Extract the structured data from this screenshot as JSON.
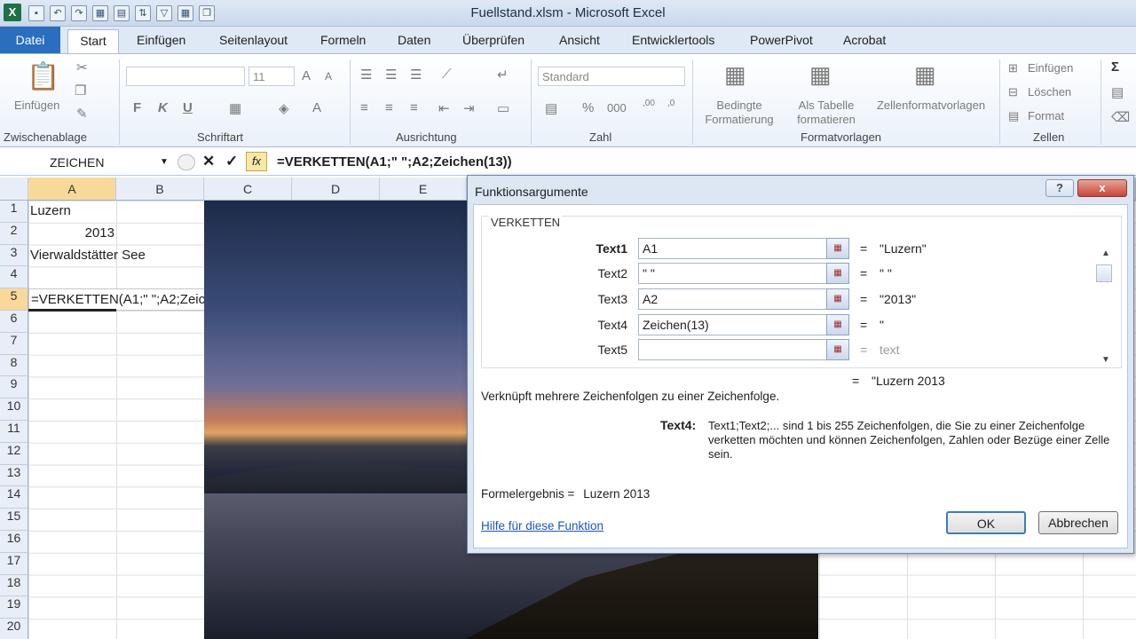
{
  "window": {
    "title": "Fuellstand.xlsm  -  Microsoft Excel",
    "app_icon": "X"
  },
  "tabs": {
    "file": "Datei",
    "items": [
      "Start",
      "Einfügen",
      "Seitenlayout",
      "Formeln",
      "Daten",
      "Überprüfen",
      "Ansicht",
      "Entwicklertools",
      "PowerPivot",
      "Acrobat"
    ],
    "active": "Start"
  },
  "ribbon": {
    "clipboard": {
      "paste": "Einfügen",
      "label": "Zwischenablage"
    },
    "font": {
      "name": "",
      "size": "11",
      "label": "Schriftart",
      "bold": "F",
      "italic": "K",
      "underline": "U"
    },
    "alignment": {
      "label": "Ausrichtung"
    },
    "number": {
      "format": "Standard",
      "percent": "%",
      "thousands": "000",
      "label": "Zahl"
    },
    "styles": {
      "conditional": "Bedingte\nFormatierung",
      "as_table": "Als Tabelle\nformatieren",
      "cell_styles": "Zellenformatvorlagen",
      "label": "Formatvorlagen"
    },
    "cells": {
      "insert": "Einfügen",
      "delete": "Löschen",
      "format": "Format",
      "label": "Zellen"
    }
  },
  "formula_bar": {
    "name_box": "ZEICHEN",
    "formula": "=VERKETTEN(A1;\" \";A2;Zeichen(13))",
    "fx": "fx"
  },
  "sheet": {
    "columns": [
      "A",
      "B",
      "C",
      "D",
      "E"
    ],
    "rows": [
      "1",
      "2",
      "3",
      "4",
      "5",
      "6",
      "7",
      "8",
      "9",
      "10",
      "11",
      "12",
      "13",
      "14",
      "15",
      "16",
      "17",
      "18",
      "19",
      "20"
    ],
    "cells": {
      "A1": "Luzern",
      "A2": "2013",
      "A3": "Vierwaldstätter See",
      "A5": "=VERKETTEN(A1;\" \";A2;Zeichen(13))"
    }
  },
  "dialog": {
    "title": "Funktionsargumente",
    "function": "VERKETTEN",
    "args": [
      {
        "label": "Text1",
        "value": "A1",
        "result": "\"Luzern\""
      },
      {
        "label": "Text2",
        "value": "\" \"",
        "result": "\" \""
      },
      {
        "label": "Text3",
        "value": "A2",
        "result": "\"2013\""
      },
      {
        "label": "Text4",
        "value": "Zeichen(13)",
        "result": "\""
      },
      {
        "label": "Text5",
        "value": "",
        "result": "text"
      }
    ],
    "total_result": "\"Luzern 2013",
    "description": "Verknüpft mehrere Zeichenfolgen zu einer Zeichenfolge.",
    "arg_help_name": "Text4:",
    "arg_help_text": "Text1;Text2;... sind 1 bis 255 Zeichenfolgen, die Sie zu einer Zeichenfolge verketten möchten und können Zeichenfolgen, Zahlen oder Bezüge einer Zelle sein.",
    "formula_result_label": "Formelergebnis =",
    "formula_result": "Luzern 2013",
    "help_link": "Hilfe für diese Funktion",
    "ok": "OK",
    "cancel": "Abbrechen",
    "help_btn": "?",
    "close_btn": "x"
  }
}
